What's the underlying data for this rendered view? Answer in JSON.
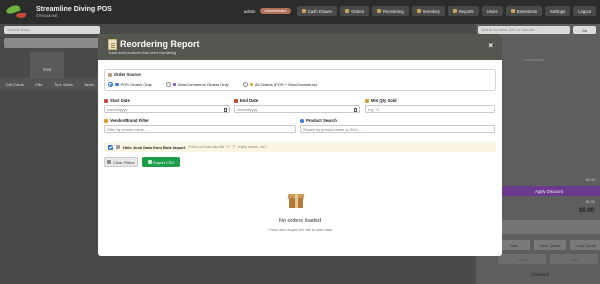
{
  "app": {
    "title": "Streamline Diving POS",
    "subtitle": "STREAMLINE",
    "user": "admin",
    "role_badge": "Administrator",
    "nav": [
      "Cash Drawer",
      "Orders",
      "Reordering",
      "Inventory",
      "Reports",
      "Users",
      "Extensions",
      "Settings",
      "Logout"
    ]
  },
  "background": {
    "product_search_placeholder": "Search items...",
    "pos_label": "POS",
    "categories": [
      "Gift Cards",
      "Fills",
      "Tour Sales",
      "Items"
    ],
    "customer_search_placeholder": "Search by name, SKU or barcode...",
    "go_label": "Go",
    "cart_empty": "Cart is empty",
    "price_small_1": "$0.00",
    "apply_discount": "Apply Discount",
    "price_small_2": "$0.00",
    "total": "$0.00",
    "btn_row": [
      "Sale",
      "Save Quote",
      "Load Quote"
    ],
    "btn_row2": [
      "Clear",
      "Void"
    ],
    "checkout": "Checkout"
  },
  "modal": {
    "title": "Reordering Report",
    "subtitle": "Track sold products that need reordering",
    "close": "×",
    "order_source_label": "Order Source",
    "sources": [
      {
        "label": "POS Orders Only",
        "checked": true,
        "color": "#3a7bd5"
      },
      {
        "label": "WooCommerce Orders Only",
        "checked": false,
        "color": "#7b4fbf"
      },
      {
        "label": "All Orders (POS + WooCommerce)",
        "checked": false,
        "color": "#e0a030"
      }
    ],
    "start_date_label": "Start Date",
    "start_date_placeholder": "mm/dd/yyyy",
    "end_date_label": "End Date",
    "end_date_placeholder": "mm/dd/yyyy",
    "min_qty_label": "Min Qty Sold",
    "min_qty_placeholder": "e.g., 5",
    "vendor_label": "Vendor/Brand Filter",
    "vendor_placeholder": "Filter by vendor name...",
    "product_search_label": "Product Search",
    "product_search_placeholder": "Search by product name or SKU...",
    "junk_label": "Hide Junk Data from Bulk Import",
    "junk_hint": "(Filters out bad data like \"1\", \"2\", empty names, etc.)",
    "clear_filters": "Clear Filters",
    "export_csv": "Export CSV",
    "empty_title": "No orders loaded",
    "empty_sub": "Close and reopen the tab to load data"
  }
}
